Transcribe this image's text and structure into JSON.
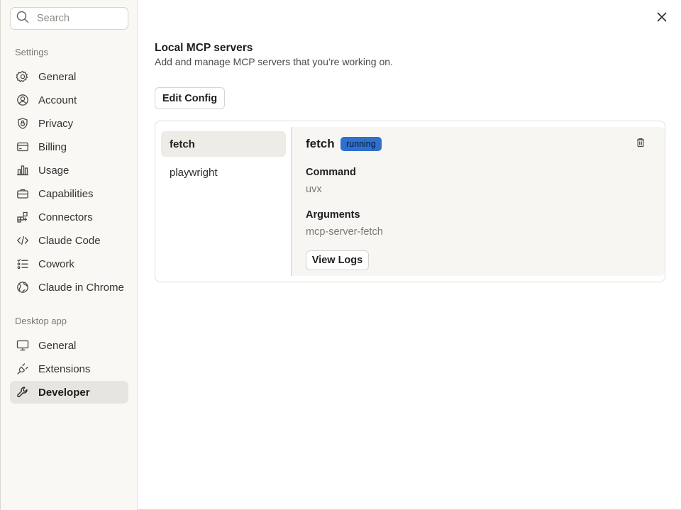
{
  "search": {
    "placeholder": "Search"
  },
  "sidebar": {
    "settings_label": "Settings",
    "settings_items": [
      {
        "label": "General",
        "icon": "gear-icon"
      },
      {
        "label": "Account",
        "icon": "user-circle-icon"
      },
      {
        "label": "Privacy",
        "icon": "shield-icon"
      },
      {
        "label": "Billing",
        "icon": "credit-card-icon"
      },
      {
        "label": "Usage",
        "icon": "bar-chart-icon"
      },
      {
        "label": "Capabilities",
        "icon": "briefcase-icon"
      },
      {
        "label": "Connectors",
        "icon": "grid-plus-icon"
      },
      {
        "label": "Claude Code",
        "icon": "code-icon"
      },
      {
        "label": "Cowork",
        "icon": "checklist-icon"
      },
      {
        "label": "Claude in Chrome",
        "icon": "globe-icon"
      }
    ],
    "desktop_label": "Desktop app",
    "desktop_items": [
      {
        "label": "General",
        "icon": "monitor-icon"
      },
      {
        "label": "Extensions",
        "icon": "plug-icon"
      },
      {
        "label": "Developer",
        "icon": "wrench-icon",
        "active": true
      }
    ]
  },
  "main": {
    "title": "Local MCP servers",
    "subtitle": "Add and manage MCP servers that you’re working on.",
    "edit_config_label": "Edit Config",
    "servers": [
      {
        "name": "fetch",
        "active": true
      },
      {
        "name": "playwright",
        "active": false
      }
    ],
    "detail": {
      "name": "fetch",
      "status": "running",
      "status_color": "#2f6fce",
      "command_label": "Command",
      "command_value": "uvx",
      "arguments_label": "Arguments",
      "arguments_value": "mcp-server-fetch",
      "view_logs_label": "View Logs"
    }
  }
}
